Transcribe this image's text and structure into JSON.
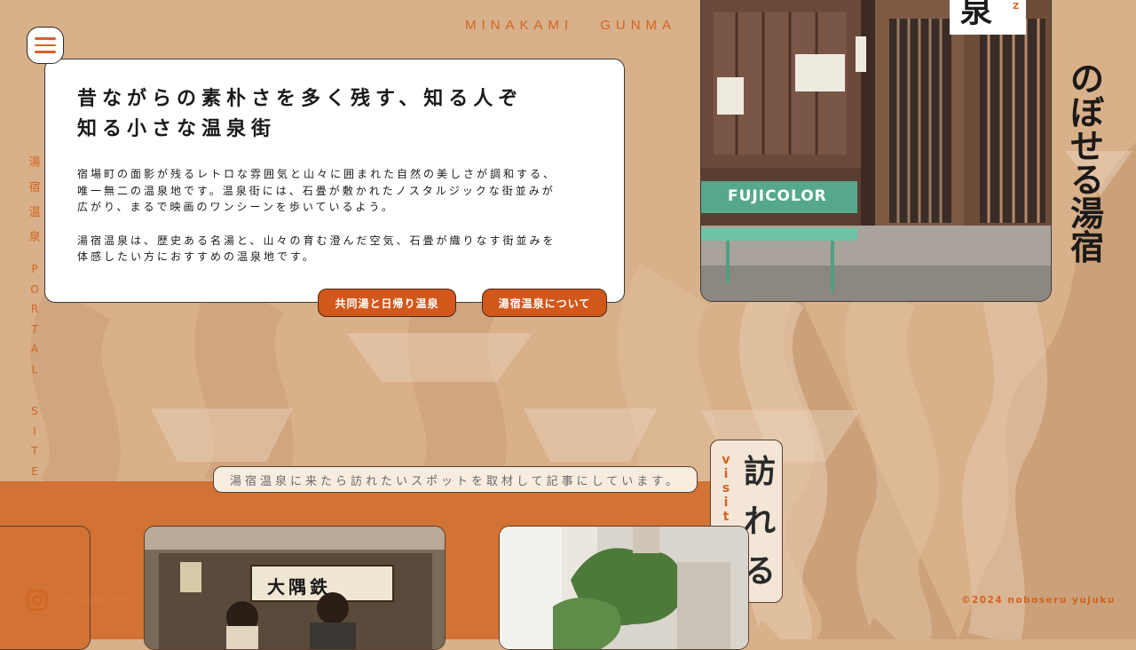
{
  "header": {
    "location": [
      "MINAKAMI",
      "GUNMA"
    ]
  },
  "menu": {
    "icon": "hamburger-icon"
  },
  "intro": {
    "title_lines": [
      "昔ながらの素朴さを多く残す、知る人ぞ",
      "知る小さな温泉街"
    ],
    "paragraph1_lines": [
      "宿場町の面影が残るレトロな雰囲気と山々に囲まれた自然の美しさが調和する、",
      "唯一無二の温泉地です。温泉街には、石畳が敷かれたノスタルジックな街並みが",
      "広がり、まるで映画のワンシーンを歩いているよう。"
    ],
    "paragraph2_lines": [
      "湯宿温泉は、歴史ある名湯と、山々の育む澄んだ空気、石畳が織りなす街並みを",
      "体感したい方におすすめの温泉地です。"
    ]
  },
  "buttons": {
    "baths": "共同湯と日帰り温泉",
    "about": "湯宿温泉について"
  },
  "side_label": {
    "jp": [
      "湯",
      "宿",
      "温",
      "泉"
    ],
    "en1": [
      "P",
      "O",
      "R",
      "T",
      "A",
      "L"
    ],
    "en2": [
      "S",
      "I",
      "T",
      "E"
    ]
  },
  "hero_photo": {
    "sign_text": "FUJICOLOR",
    "sign_char": "泉",
    "partial_letter": "Z"
  },
  "logo": {
    "chars": [
      "の",
      "ぼ",
      "せ",
      "る",
      "湯",
      "宿"
    ]
  },
  "visit": {
    "caption": "湯宿温泉に来たら訪れたいスポットを取材して記事にしています。",
    "en": [
      "v",
      "i",
      "s",
      "i",
      "t"
    ],
    "jp": [
      "訪",
      "れ",
      "る"
    ]
  },
  "spots": {
    "shop_sign": "大隅鉄"
  },
  "footer": {
    "follow": "FOLLOW ME!",
    "copyright": "©2024 noboseru yujuku"
  },
  "colors": {
    "accent": "#d2651f",
    "button": "#d2571b",
    "background": "#d8b08a",
    "band": "#d27234"
  }
}
